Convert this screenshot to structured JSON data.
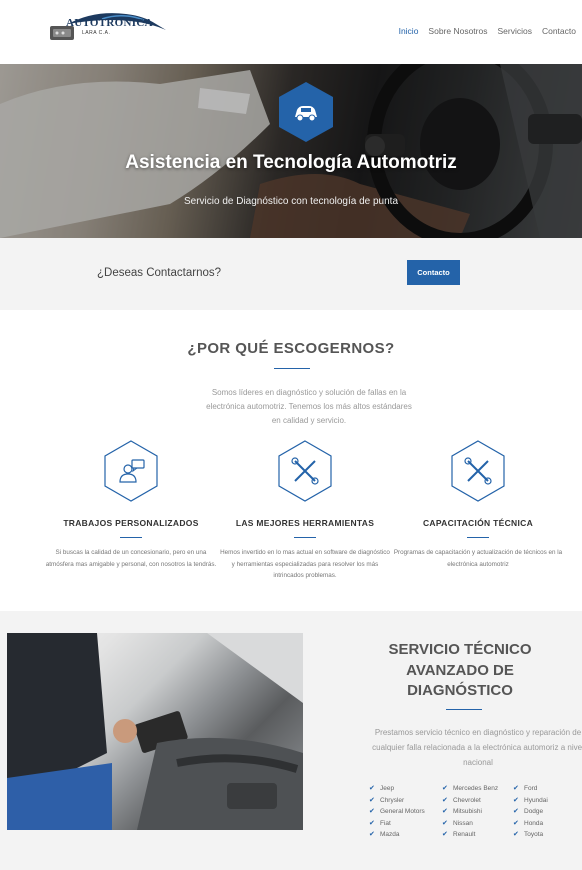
{
  "brand": {
    "name": "AUTOTRÓNICA",
    "sub": "LARA C.A."
  },
  "nav": [
    {
      "label": "Inicio",
      "active": true
    },
    {
      "label": "Sobre Nosotros",
      "active": false
    },
    {
      "label": "Servicios",
      "active": false
    },
    {
      "label": "Contacto",
      "active": false
    }
  ],
  "hero": {
    "title": "Asistencia en Tecnología Automotriz",
    "subtitle": "Servicio de Diagnóstico con tecnología de punta"
  },
  "cta": {
    "text": "¿Deseas Contactarnos?",
    "button": "Contacto"
  },
  "why": {
    "title": "¿POR QUÉ ESCOGERNOS?",
    "text": "Somos líderes en diagnóstico y solución de fallas en la electrónica automotriz. Tenemos los más altos estándares en calidad y servicio.",
    "features": [
      {
        "icon": "customer-support-icon",
        "title": "TRABAJOS PERSONALIZADOS",
        "text": "Si buscas la calidad de un concesionario, pero en una atmósfera mas amigable y personal, con nosotros la tendrás."
      },
      {
        "icon": "tools-icon",
        "title": "LAS MEJORES HERRAMIENTAS",
        "text": "Hemos invertido en lo mas actual en software de diagnóstico y herramientas especializadas para resolver los más intrincados problemas."
      },
      {
        "icon": "tools-icon",
        "title": "CAPACITACIÓN TÉCNICA",
        "text": "Programas de capacitación y actualización de técnicos en la electrónica automotriz"
      }
    ]
  },
  "service": {
    "title": "SERVICIO TÉCNICO AVANZADO DE DIAGNÓSTICO",
    "text": "Prestamos servicio técnico en diagnóstico y reparación de cualquier falla relacionada a la electrónica automoriz a nivel nacional",
    "brands": [
      [
        "Jeep",
        "Chrysler",
        "General Motors",
        "Fiat",
        "Mazda"
      ],
      [
        "Mercedes Benz",
        "Chevrolet",
        "Mitsubishi",
        "Nissan",
        "Renault"
      ],
      [
        "Ford",
        "Hyundai",
        "Dodge",
        "Honda",
        "Toyota"
      ]
    ]
  },
  "colors": {
    "accent": "#2463a9",
    "light_bg": "#f3f3f3"
  }
}
